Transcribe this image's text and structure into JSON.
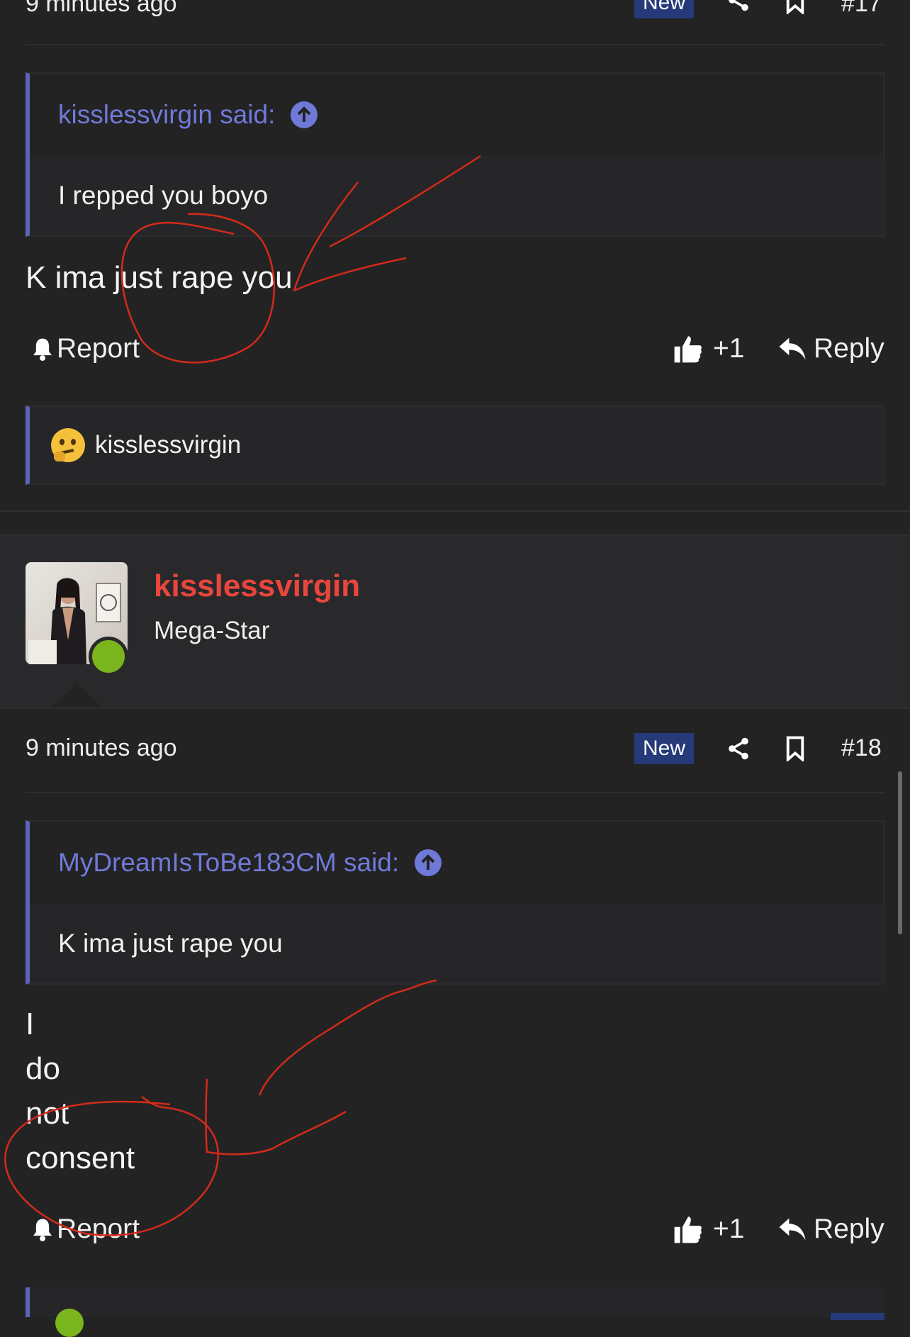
{
  "post17": {
    "time": "9 minutes ago",
    "badge": "New",
    "number": "#17",
    "quote_author": "kisslessvirgin said:",
    "quote_text": "I repped you boyo",
    "text": "K ima just rape you",
    "report_label": "Report",
    "like_label": "+1",
    "reply_label": "Reply",
    "reaction_user": "kisslessvirgin",
    "reaction_icon": "thinking-face-emoji"
  },
  "post18": {
    "username": "kisslessvirgin",
    "user_title": "Mega-Star",
    "time": "9 minutes ago",
    "badge": "New",
    "number": "#18",
    "quote_author": "MyDreamIsToBe183CM said:",
    "quote_text": "K ima just rape you",
    "text_lines": [
      "I",
      "do",
      "not",
      "consent"
    ],
    "report_label": "Report",
    "like_label": "+1",
    "reply_label": "Reply"
  },
  "colors": {
    "background": "#232324",
    "quote_accent": "#5b64b6",
    "quote_link": "#6f7ad8",
    "new_badge": "#263a7a",
    "username": "#e8463d",
    "online": "#7ab51d",
    "annotation": "#d42a1a"
  },
  "icons": [
    "share-icon",
    "bookmark-icon",
    "bell-icon",
    "thumbs-up-icon",
    "reply-icon",
    "arrow-up-circle-icon"
  ]
}
